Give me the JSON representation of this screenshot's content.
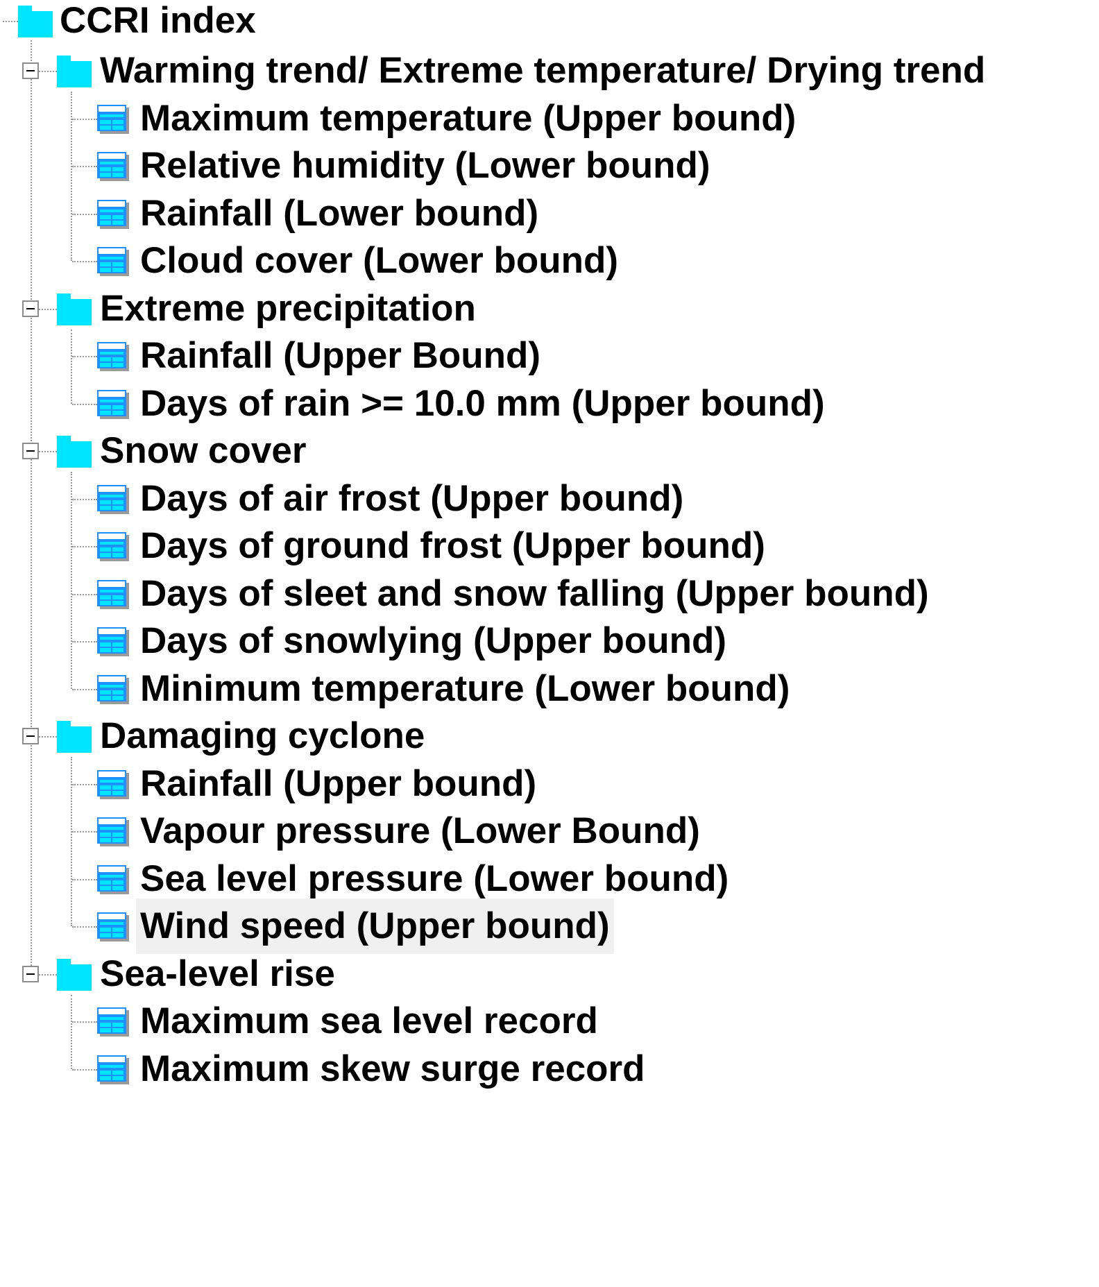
{
  "tree": {
    "root": {
      "label": "CCRI index",
      "icon": "folder-icon"
    },
    "groups": [
      {
        "label": "Warming trend/ Extreme temperature/ Drying trend",
        "expanded": true,
        "items": [
          "Maximum temperature (Upper bound)",
          "Relative humidity (Lower bound)",
          "Rainfall (Lower bound)",
          "Cloud cover (Lower bound)"
        ]
      },
      {
        "label": "Extreme precipitation",
        "expanded": true,
        "items": [
          "Rainfall (Upper Bound)",
          "Days of rain >= 10.0 mm (Upper bound)"
        ]
      },
      {
        "label": "Snow cover",
        "expanded": true,
        "items": [
          "Days of air frost (Upper bound)",
          "Days of ground frost (Upper bound)",
          "Days of sleet and snow falling (Upper bound)",
          "Days of snowlying (Upper bound)",
          "Minimum temperature (Lower bound)"
        ]
      },
      {
        "label": "Damaging cyclone",
        "expanded": true,
        "items": [
          "Rainfall (Upper bound)",
          "Vapour pressure (Lower Bound)",
          "Sea level pressure (Lower bound)",
          "Wind speed (Upper bound)"
        ]
      },
      {
        "label": "Sea-level rise",
        "expanded": true,
        "items": [
          "Maximum sea level record",
          "Maximum skew surge record"
        ]
      }
    ],
    "selected_item": "Wind speed (Upper bound)",
    "colors": {
      "folder": "#00e5ff",
      "table_icon_body": "#1e90ff",
      "table_icon_header": "#00e5ff",
      "selection_bg": "#f0f0f0"
    }
  }
}
